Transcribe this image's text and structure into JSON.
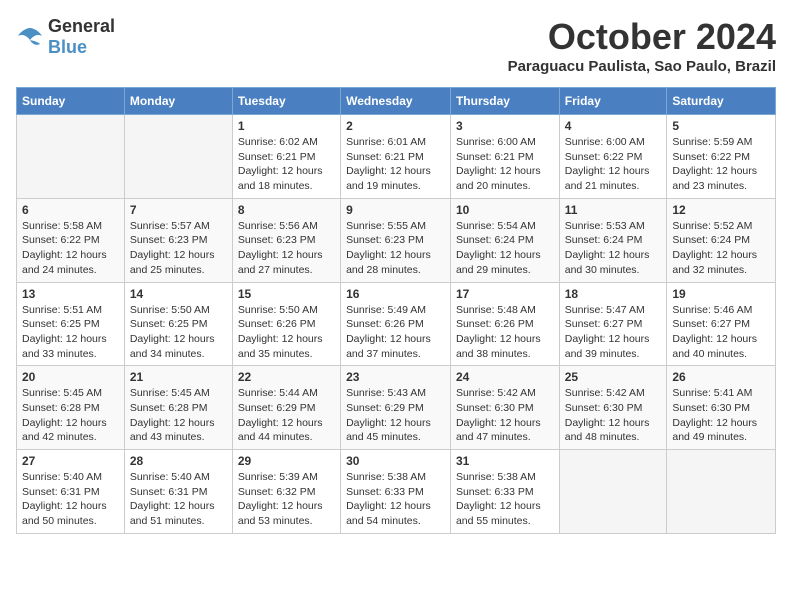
{
  "header": {
    "logo": {
      "text_general": "General",
      "text_blue": "Blue"
    },
    "month_title": "October 2024",
    "location": "Paraguacu Paulista, Sao Paulo, Brazil"
  },
  "calendar": {
    "days_of_week": [
      "Sunday",
      "Monday",
      "Tuesday",
      "Wednesday",
      "Thursday",
      "Friday",
      "Saturday"
    ],
    "weeks": [
      [
        {
          "day": "",
          "sunrise": "",
          "sunset": "",
          "daylight": ""
        },
        {
          "day": "",
          "sunrise": "",
          "sunset": "",
          "daylight": ""
        },
        {
          "day": "1",
          "sunrise": "Sunrise: 6:02 AM",
          "sunset": "Sunset: 6:21 PM",
          "daylight": "Daylight: 12 hours and 18 minutes."
        },
        {
          "day": "2",
          "sunrise": "Sunrise: 6:01 AM",
          "sunset": "Sunset: 6:21 PM",
          "daylight": "Daylight: 12 hours and 19 minutes."
        },
        {
          "day": "3",
          "sunrise": "Sunrise: 6:00 AM",
          "sunset": "Sunset: 6:21 PM",
          "daylight": "Daylight: 12 hours and 20 minutes."
        },
        {
          "day": "4",
          "sunrise": "Sunrise: 6:00 AM",
          "sunset": "Sunset: 6:22 PM",
          "daylight": "Daylight: 12 hours and 21 minutes."
        },
        {
          "day": "5",
          "sunrise": "Sunrise: 5:59 AM",
          "sunset": "Sunset: 6:22 PM",
          "daylight": "Daylight: 12 hours and 23 minutes."
        }
      ],
      [
        {
          "day": "6",
          "sunrise": "Sunrise: 5:58 AM",
          "sunset": "Sunset: 6:22 PM",
          "daylight": "Daylight: 12 hours and 24 minutes."
        },
        {
          "day": "7",
          "sunrise": "Sunrise: 5:57 AM",
          "sunset": "Sunset: 6:23 PM",
          "daylight": "Daylight: 12 hours and 25 minutes."
        },
        {
          "day": "8",
          "sunrise": "Sunrise: 5:56 AM",
          "sunset": "Sunset: 6:23 PM",
          "daylight": "Daylight: 12 hours and 27 minutes."
        },
        {
          "day": "9",
          "sunrise": "Sunrise: 5:55 AM",
          "sunset": "Sunset: 6:23 PM",
          "daylight": "Daylight: 12 hours and 28 minutes."
        },
        {
          "day": "10",
          "sunrise": "Sunrise: 5:54 AM",
          "sunset": "Sunset: 6:24 PM",
          "daylight": "Daylight: 12 hours and 29 minutes."
        },
        {
          "day": "11",
          "sunrise": "Sunrise: 5:53 AM",
          "sunset": "Sunset: 6:24 PM",
          "daylight": "Daylight: 12 hours and 30 minutes."
        },
        {
          "day": "12",
          "sunrise": "Sunrise: 5:52 AM",
          "sunset": "Sunset: 6:24 PM",
          "daylight": "Daylight: 12 hours and 32 minutes."
        }
      ],
      [
        {
          "day": "13",
          "sunrise": "Sunrise: 5:51 AM",
          "sunset": "Sunset: 6:25 PM",
          "daylight": "Daylight: 12 hours and 33 minutes."
        },
        {
          "day": "14",
          "sunrise": "Sunrise: 5:50 AM",
          "sunset": "Sunset: 6:25 PM",
          "daylight": "Daylight: 12 hours and 34 minutes."
        },
        {
          "day": "15",
          "sunrise": "Sunrise: 5:50 AM",
          "sunset": "Sunset: 6:26 PM",
          "daylight": "Daylight: 12 hours and 35 minutes."
        },
        {
          "day": "16",
          "sunrise": "Sunrise: 5:49 AM",
          "sunset": "Sunset: 6:26 PM",
          "daylight": "Daylight: 12 hours and 37 minutes."
        },
        {
          "day": "17",
          "sunrise": "Sunrise: 5:48 AM",
          "sunset": "Sunset: 6:26 PM",
          "daylight": "Daylight: 12 hours and 38 minutes."
        },
        {
          "day": "18",
          "sunrise": "Sunrise: 5:47 AM",
          "sunset": "Sunset: 6:27 PM",
          "daylight": "Daylight: 12 hours and 39 minutes."
        },
        {
          "day": "19",
          "sunrise": "Sunrise: 5:46 AM",
          "sunset": "Sunset: 6:27 PM",
          "daylight": "Daylight: 12 hours and 40 minutes."
        }
      ],
      [
        {
          "day": "20",
          "sunrise": "Sunrise: 5:45 AM",
          "sunset": "Sunset: 6:28 PM",
          "daylight": "Daylight: 12 hours and 42 minutes."
        },
        {
          "day": "21",
          "sunrise": "Sunrise: 5:45 AM",
          "sunset": "Sunset: 6:28 PM",
          "daylight": "Daylight: 12 hours and 43 minutes."
        },
        {
          "day": "22",
          "sunrise": "Sunrise: 5:44 AM",
          "sunset": "Sunset: 6:29 PM",
          "daylight": "Daylight: 12 hours and 44 minutes."
        },
        {
          "day": "23",
          "sunrise": "Sunrise: 5:43 AM",
          "sunset": "Sunset: 6:29 PM",
          "daylight": "Daylight: 12 hours and 45 minutes."
        },
        {
          "day": "24",
          "sunrise": "Sunrise: 5:42 AM",
          "sunset": "Sunset: 6:30 PM",
          "daylight": "Daylight: 12 hours and 47 minutes."
        },
        {
          "day": "25",
          "sunrise": "Sunrise: 5:42 AM",
          "sunset": "Sunset: 6:30 PM",
          "daylight": "Daylight: 12 hours and 48 minutes."
        },
        {
          "day": "26",
          "sunrise": "Sunrise: 5:41 AM",
          "sunset": "Sunset: 6:30 PM",
          "daylight": "Daylight: 12 hours and 49 minutes."
        }
      ],
      [
        {
          "day": "27",
          "sunrise": "Sunrise: 5:40 AM",
          "sunset": "Sunset: 6:31 PM",
          "daylight": "Daylight: 12 hours and 50 minutes."
        },
        {
          "day": "28",
          "sunrise": "Sunrise: 5:40 AM",
          "sunset": "Sunset: 6:31 PM",
          "daylight": "Daylight: 12 hours and 51 minutes."
        },
        {
          "day": "29",
          "sunrise": "Sunrise: 5:39 AM",
          "sunset": "Sunset: 6:32 PM",
          "daylight": "Daylight: 12 hours and 53 minutes."
        },
        {
          "day": "30",
          "sunrise": "Sunrise: 5:38 AM",
          "sunset": "Sunset: 6:33 PM",
          "daylight": "Daylight: 12 hours and 54 minutes."
        },
        {
          "day": "31",
          "sunrise": "Sunrise: 5:38 AM",
          "sunset": "Sunset: 6:33 PM",
          "daylight": "Daylight: 12 hours and 55 minutes."
        },
        {
          "day": "",
          "sunrise": "",
          "sunset": "",
          "daylight": ""
        },
        {
          "day": "",
          "sunrise": "",
          "sunset": "",
          "daylight": ""
        }
      ]
    ]
  }
}
